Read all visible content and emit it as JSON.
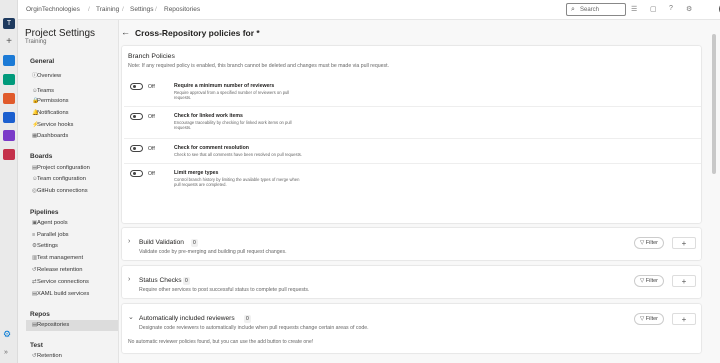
{
  "rail": {
    "initial": "T"
  },
  "breadcrumb": [
    "OrginTechnologies",
    "Training",
    "Settings",
    "Repositories"
  ],
  "breadcrumb_sep": "/",
  "search": {
    "placeholder": "Search",
    "icon": "search-icon"
  },
  "sidebar": {
    "title": "Project Settings",
    "subtitle": "Training",
    "sections": [
      {
        "heading": "General",
        "items": [
          "Overview",
          "Teams",
          "Permissions",
          "Notifications",
          "Service hooks",
          "Dashboards"
        ]
      },
      {
        "heading": "Boards",
        "items": [
          "Project configuration",
          "Team configuration",
          "GitHub connections"
        ]
      },
      {
        "heading": "Pipelines",
        "items": [
          "Agent pools",
          "Parallel jobs",
          "Settings",
          "Test management",
          "Release retention",
          "Service connections",
          "XAML build services"
        ]
      },
      {
        "heading": "Repos",
        "items": [
          "Repositories"
        ]
      },
      {
        "heading": "Test",
        "items": [
          "Retention"
        ]
      }
    ],
    "active": "Repositories"
  },
  "page": {
    "title": "Cross-Repository policies for *"
  },
  "branch_policies": {
    "title": "Branch Policies",
    "note": "Note: If any required policy is enabled, this branch cannot be deleted and changes must be made via pull request.",
    "policies": [
      {
        "state": "Off",
        "title": "Require a minimum number of reviewers",
        "desc": "Require approval from a specified number of reviewers on pull requests."
      },
      {
        "state": "Off",
        "title": "Check for linked work items",
        "desc": "Encourage traceability by checking for linked work items on pull requests."
      },
      {
        "state": "Off",
        "title": "Check for comment resolution",
        "desc": "Check to see that all comments have been resolved on pull requests."
      },
      {
        "state": "Off",
        "title": "Limit merge types",
        "desc": "Control branch history by limiting the available types of merge when pull requests are completed."
      }
    ]
  },
  "sections": [
    {
      "title": "Build Validation",
      "count": "0",
      "desc": "Validate code by pre-merging and building pull request changes.",
      "filter": "Filter",
      "add": "+"
    },
    {
      "title": "Status Checks",
      "count": "0",
      "desc": "Require other services to post successful status to complete pull requests.",
      "filter": "Filter",
      "add": "+"
    },
    {
      "title": "Automatically included reviewers",
      "count": "0",
      "desc": "Designate code reviewers to automatically include when pull requests change certain areas of code.",
      "filter": "Filter",
      "add": "+",
      "empty": "No automatic reviewer policies found, but you can use the add button to create one!"
    }
  ]
}
